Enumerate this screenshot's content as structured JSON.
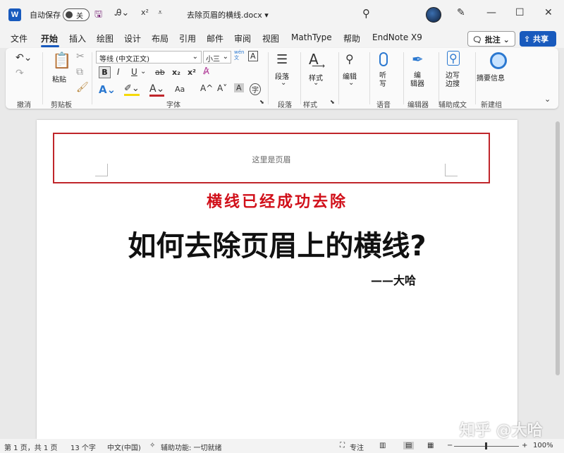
{
  "titlebar": {
    "app_icon": "W",
    "autosave_label": "自动保存",
    "autosave_state": "关",
    "doc_title": "去除页眉的横线.docx ▾"
  },
  "menu": {
    "tabs": [
      "文件",
      "开始",
      "插入",
      "绘图",
      "设计",
      "布局",
      "引用",
      "邮件",
      "审阅",
      "视图",
      "MathType",
      "帮助",
      "EndNote X9"
    ],
    "active_tab": "开始",
    "comment_label": "批注",
    "share_label": "共享"
  },
  "ribbon": {
    "groups": [
      "撤消",
      "剪贴板",
      "字体",
      "段落",
      "样式",
      "语音",
      "编辑器",
      "辅助成文",
      "新建组"
    ],
    "paste_label": "粘贴",
    "font_name": "等线 (中文正文)",
    "font_size": "小三",
    "paragraph_label": "段落",
    "style_label": "样式",
    "edit_label": "编辑",
    "dictate_label": "听\n写",
    "editor_label": "编\n辑器",
    "margin_label": "边写\n边搜",
    "abstract_label": "摘要信息",
    "wen_label": "wén\n文",
    "font_buttons": [
      "B",
      "I",
      "U",
      "ab",
      "x₂",
      "x²"
    ],
    "size_buttons": [
      "Aa",
      "A^",
      "A˅",
      "A",
      "字"
    ],
    "accent_color": "#185abd",
    "highlight_color": "#f5d90a",
    "font_color": "#c0262b"
  },
  "document": {
    "header_text": "这里是页眉",
    "red_note": "横线已经成功去除",
    "title": "如何去除页眉上的横线?",
    "author": "——大哈",
    "note_color": "#d1101a",
    "header_border_color": "#c0262b"
  },
  "status": {
    "page_info": "第 1 页，共 1 页",
    "word_count": "13 个字",
    "language": "中文(中国)",
    "accessibility": "辅助功能: 一切就绪",
    "focus_label": "专注",
    "zoom": "100%"
  },
  "watermark": "知乎 @大哈"
}
